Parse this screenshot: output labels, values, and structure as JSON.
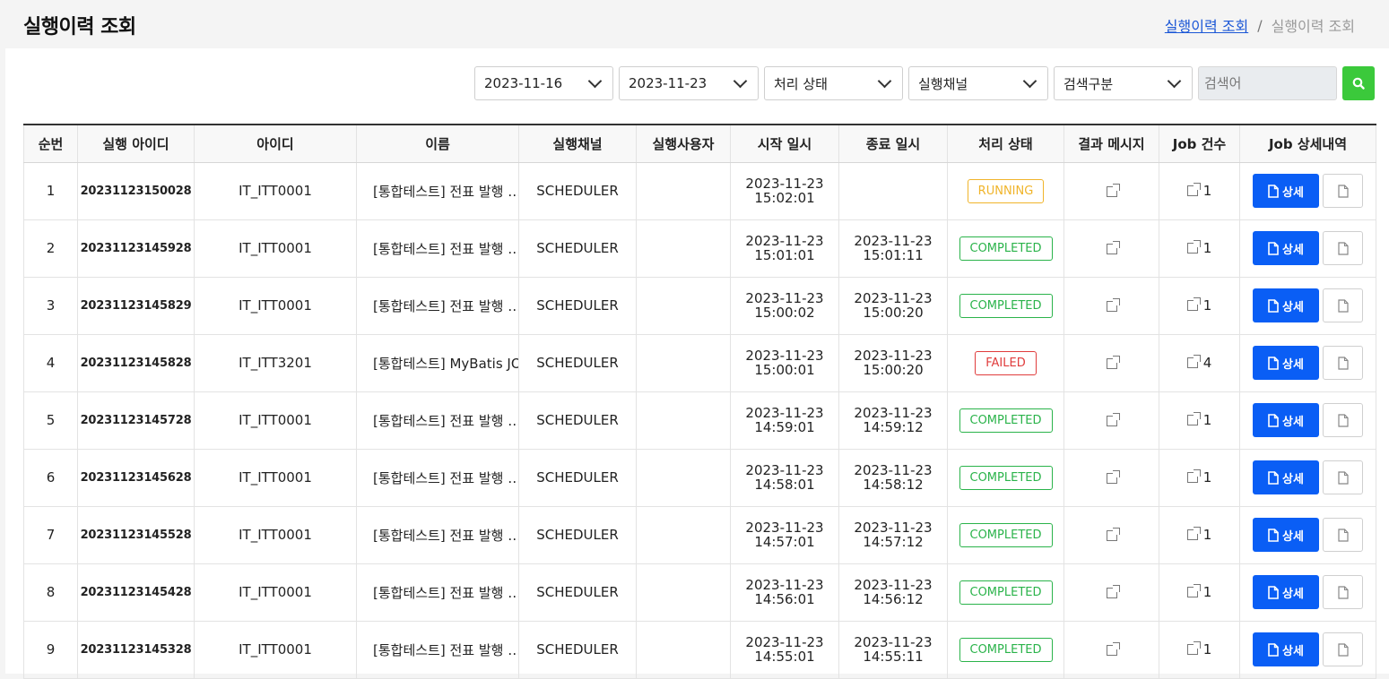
{
  "header": {
    "title": "실행이력 조회",
    "breadcrumb": {
      "link": "실행이력 조회",
      "separator": "/",
      "current": "실행이력 조회"
    }
  },
  "filters": {
    "date_from": "2023-11-16",
    "date_to": "2023-11-23",
    "status": "처리 상태",
    "channel": "실행채널",
    "search_type": "검색구분",
    "search_placeholder": "검색어",
    "search_icon": "search-icon",
    "accent_color": "#3bc93b"
  },
  "table": {
    "columns": [
      "순번",
      "실행 아이디",
      "아이디",
      "이름",
      "실행채널",
      "실행사용자",
      "시작 일시",
      "종료 일시",
      "처리 상태",
      "결과 메시지",
      "Job 건수",
      "Job 상세내역"
    ],
    "detail_label": "상세",
    "rows": [
      {
        "no": "1",
        "exec_id": "20231123150028",
        "id": "IT_ITT0001",
        "name": "[통합테스트] 전표 발행 …",
        "channel": "SCHEDULER",
        "user": "",
        "start_date": "2023-11-23",
        "start_time": "15:02:01",
        "end_date": "",
        "end_time": "",
        "status": "RUNNING",
        "jobs": "1"
      },
      {
        "no": "2",
        "exec_id": "20231123145928",
        "id": "IT_ITT0001",
        "name": "[통합테스트] 전표 발행 …",
        "channel": "SCHEDULER",
        "user": "",
        "start_date": "2023-11-23",
        "start_time": "15:01:01",
        "end_date": "2023-11-23",
        "end_time": "15:01:11",
        "status": "COMPLETED",
        "jobs": "1"
      },
      {
        "no": "3",
        "exec_id": "20231123145829",
        "id": "IT_ITT0001",
        "name": "[통합테스트] 전표 발행 …",
        "channel": "SCHEDULER",
        "user": "",
        "start_date": "2023-11-23",
        "start_time": "15:00:02",
        "end_date": "2023-11-23",
        "end_time": "15:00:20",
        "status": "COMPLETED",
        "jobs": "1"
      },
      {
        "no": "4",
        "exec_id": "20231123145828",
        "id": "IT_ITT3201",
        "name": "[통합테스트] MyBatis JO",
        "channel": "SCHEDULER",
        "user": "",
        "start_date": "2023-11-23",
        "start_time": "15:00:01",
        "end_date": "2023-11-23",
        "end_time": "15:00:20",
        "status": "FAILED",
        "jobs": "4"
      },
      {
        "no": "5",
        "exec_id": "20231123145728",
        "id": "IT_ITT0001",
        "name": "[통합테스트] 전표 발행 …",
        "channel": "SCHEDULER",
        "user": "",
        "start_date": "2023-11-23",
        "start_time": "14:59:01",
        "end_date": "2023-11-23",
        "end_time": "14:59:12",
        "status": "COMPLETED",
        "jobs": "1"
      },
      {
        "no": "6",
        "exec_id": "20231123145628",
        "id": "IT_ITT0001",
        "name": "[통합테스트] 전표 발행 …",
        "channel": "SCHEDULER",
        "user": "",
        "start_date": "2023-11-23",
        "start_time": "14:58:01",
        "end_date": "2023-11-23",
        "end_time": "14:58:12",
        "status": "COMPLETED",
        "jobs": "1"
      },
      {
        "no": "7",
        "exec_id": "20231123145528",
        "id": "IT_ITT0001",
        "name": "[통합테스트] 전표 발행 …",
        "channel": "SCHEDULER",
        "user": "",
        "start_date": "2023-11-23",
        "start_time": "14:57:01",
        "end_date": "2023-11-23",
        "end_time": "14:57:12",
        "status": "COMPLETED",
        "jobs": "1"
      },
      {
        "no": "8",
        "exec_id": "20231123145428",
        "id": "IT_ITT0001",
        "name": "[통합테스트] 전표 발행 …",
        "channel": "SCHEDULER",
        "user": "",
        "start_date": "2023-11-23",
        "start_time": "14:56:01",
        "end_date": "2023-11-23",
        "end_time": "14:56:12",
        "status": "COMPLETED",
        "jobs": "1"
      },
      {
        "no": "9",
        "exec_id": "20231123145328",
        "id": "IT_ITT0001",
        "name": "[통합테스트] 전표 발행 …",
        "channel": "SCHEDULER",
        "user": "",
        "start_date": "2023-11-23",
        "start_time": "14:55:01",
        "end_date": "2023-11-23",
        "end_time": "14:55:11",
        "status": "COMPLETED",
        "jobs": "1"
      }
    ]
  },
  "colors": {
    "detail_button": "#0a5ef5",
    "running": "#f0b42a",
    "completed": "#2ab34a",
    "failed": "#e03c3c",
    "link": "#1a56d6"
  }
}
